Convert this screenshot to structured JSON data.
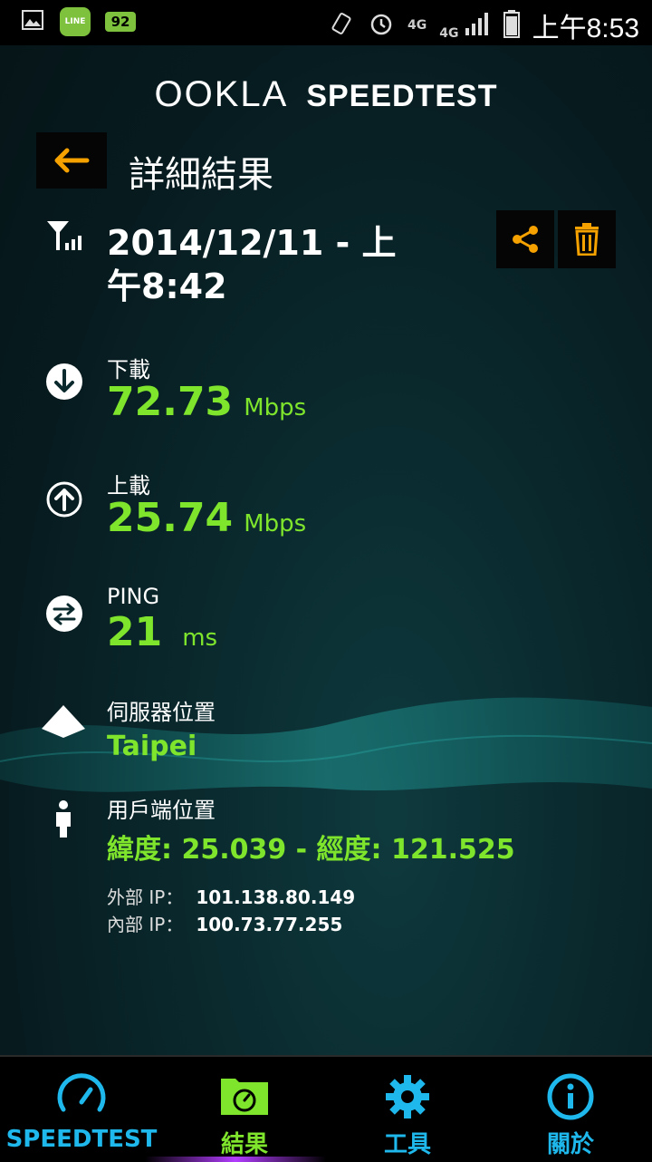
{
  "status_bar": {
    "time": "上午8:53",
    "battery_badge": "92",
    "line_app": "LINE",
    "network_1": "4G",
    "network_2": "4G"
  },
  "header": {
    "logo_ookla": "OOKLA",
    "logo_speedtest": "SPEEDTEST"
  },
  "title_bar": {
    "title": "詳細結果"
  },
  "result": {
    "datetime": "2014/12/11 - 上午8:42",
    "download": {
      "label": "下載",
      "value": "72.73",
      "unit": "Mbps"
    },
    "upload": {
      "label": "上載",
      "value": "25.74",
      "unit": "Mbps"
    },
    "ping": {
      "label": "PING",
      "value": "21",
      "unit": "ms"
    },
    "server": {
      "label": "伺服器位置",
      "value": "Taipei"
    },
    "client": {
      "label": "用戶端位置",
      "value": "緯度: 25.039 - 經度: 121.525"
    },
    "external_ip": {
      "label": "外部 IP：",
      "value": "101.138.80.149"
    },
    "internal_ip": {
      "label": "內部 IP：",
      "value": "100.73.77.255"
    }
  },
  "tabs": [
    {
      "label": "SPEEDTEST",
      "icon": "speedometer-icon"
    },
    {
      "label": "結果",
      "icon": "results-folder-icon",
      "active": true
    },
    {
      "label": "工具",
      "icon": "gear-icon"
    },
    {
      "label": "關於",
      "icon": "info-icon"
    }
  ],
  "colors": {
    "accent_green": "#7fe52c",
    "accent_orange": "#f5a100",
    "tab_blue": "#1fb8ec"
  }
}
